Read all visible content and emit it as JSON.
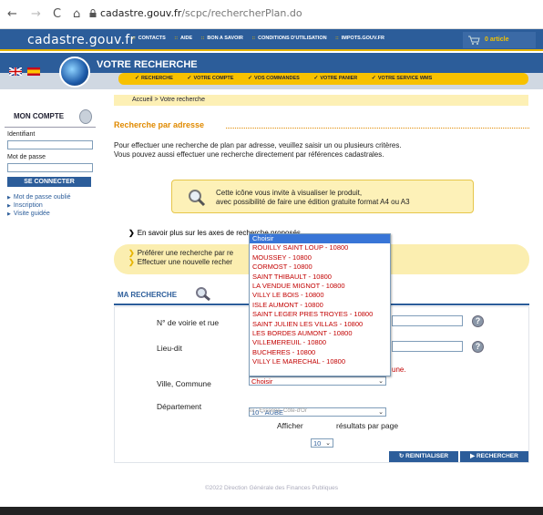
{
  "browser": {
    "back": "←",
    "forward": "→",
    "reload": "C",
    "home": "⌂",
    "url_domain": "cadastre.gouv.fr",
    "url_path": "/scpc/rechercherPlan.do"
  },
  "site": {
    "logo": "cadastre.gouv.fr",
    "top_links": [
      "CONTACTS",
      "AIDE",
      "BON A SAVOIR",
      "CONDITIONS D'UTILISATION",
      "IMPOTS.GOUV.FR"
    ],
    "cart": "0 article",
    "section_title": "VOTRE RECHERCHE",
    "sub_nav": [
      "RECHERCHE",
      "VOTRE COMPTE",
      "VOS COMMANDES",
      "VOTRE PANIER",
      "VOTRE SERVICE WMS"
    ],
    "breadcrumb": "Accueil > Votre recherche"
  },
  "account": {
    "title": "MON COMPTE",
    "id_label": "Identifiant",
    "pwd_label": "Mot de passe",
    "connect": "SE CONNECTER",
    "links": [
      "Mot de passe oublié",
      "Inscription",
      "Visite guidée"
    ]
  },
  "main": {
    "title": "Recherche par adresse",
    "intro_1": "Pour effectuer une recherche de plan par adresse, veuillez saisir un ou plusieurs critères.",
    "intro_2": "Vous pouvez aussi effectuer une recherche directement par références cadastrales.",
    "info_1": "Cette icône vous invite à visualiser le produit,",
    "info_2": "avec possibilité de faire une édition gratuite format A4 ou A3",
    "axes_link": "En savoir plus sur les axes de recherche proposés",
    "pref_1": "Préférer une recherche par re",
    "pref_2": "Effectuer une nouvelle recher",
    "mr_title": "MA RECHERCHE",
    "f_voie": "N° de voirie et rue",
    "f_lieu": "Lieu-dit",
    "f_ville": "Ville, Commune",
    "ville_value": "Choisir",
    "une_text": "une.",
    "f_dept": "Département",
    "dept_value": "10 - AUBE",
    "dept_hint": "ex : Essonne, Côte-d'Or",
    "afficher": "Afficher",
    "afficher_value": "10",
    "per_page": "résultats par page",
    "reinit": "REINITIALISER",
    "search": "RECHERCHER",
    "footer": "©2022 Direction Générale des Finances Publiques"
  },
  "dropdown": {
    "options": [
      "Choisir",
      "ROUILLY SAINT LOUP - 10800",
      "MOUSSEY - 10800",
      "CORMOST - 10800",
      "SAINT THIBAULT - 10800",
      "LA VENDUE MIGNOT - 10800",
      "VILLY LE BOIS - 10800",
      "ISLE AUMONT - 10800",
      "SAINT LEGER PRES TROYES - 10800",
      "SAINT JULIEN LES VILLAS - 10800",
      "LES BORDES AUMONT - 10800",
      "VILLEMEREUIL - 10800",
      "BUCHERES - 10800",
      "VILLY LE MARECHAL - 10800"
    ]
  }
}
